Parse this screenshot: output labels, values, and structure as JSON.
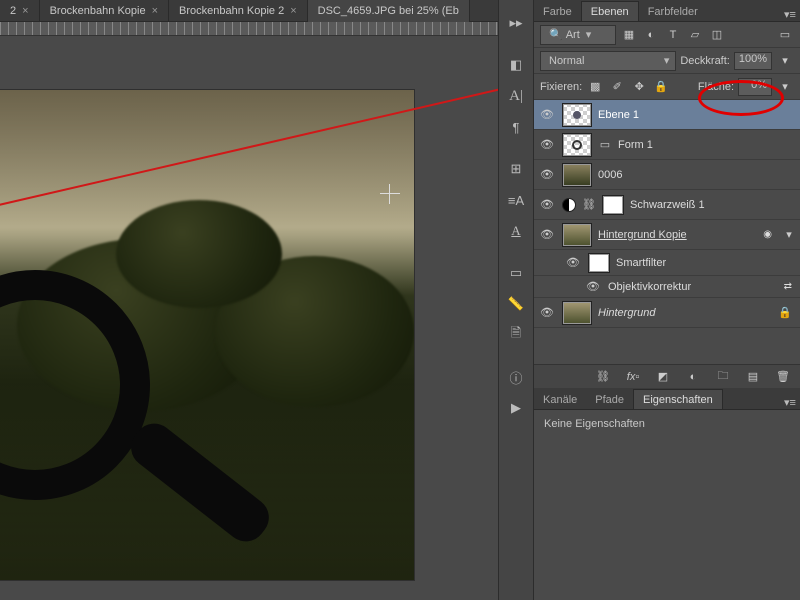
{
  "tabs": [
    {
      "label": "2"
    },
    {
      "label": "Brockenbahn Kopie"
    },
    {
      "label": "Brockenbahn Kopie 2"
    },
    {
      "label": "DSC_4659.JPG bei 25% (Eb",
      "active": true
    }
  ],
  "panel_groups": {
    "color_tabs": [
      "Farbe",
      "Ebenen",
      "Farbfelder"
    ],
    "color_active": 1,
    "channels_tabs": [
      "Kanäle",
      "Pfade",
      "Eigenschaften"
    ],
    "channels_active": 2
  },
  "layers_header": {
    "filter_label": "Art",
    "blend_mode": "Normal",
    "opacity_label": "Deckkraft:",
    "opacity_value": "100%",
    "lock_label": "Fixieren:",
    "fill_label": "Fläche:",
    "fill_value": "0%"
  },
  "layers": [
    {
      "name": "Ebene 1",
      "selected": true,
      "thumb": "checker"
    },
    {
      "name": "Form 1",
      "thumb": "checker",
      "shape": true
    },
    {
      "name": "0006",
      "thumb": "img1"
    },
    {
      "name": "Schwarzweiß 1",
      "adjustment": true
    },
    {
      "name": "Hintergrund Kopie",
      "thumb": "img2",
      "smart": true,
      "underline": true
    },
    {
      "name": "Smartfilter",
      "sub": 1,
      "thumb": "white"
    },
    {
      "name": "Objektivkorrektur",
      "sub": 2,
      "eye": true
    },
    {
      "name": "Hintergrund",
      "thumb": "img2",
      "locked": true
    }
  ],
  "properties": {
    "empty_text": "Keine Eigenschaften"
  },
  "toolstrip_icons": [
    "menu",
    "guides",
    "char-A",
    "para",
    "book",
    "styles",
    "char-A2",
    "doc",
    "ruler",
    "note",
    "info",
    "play"
  ]
}
